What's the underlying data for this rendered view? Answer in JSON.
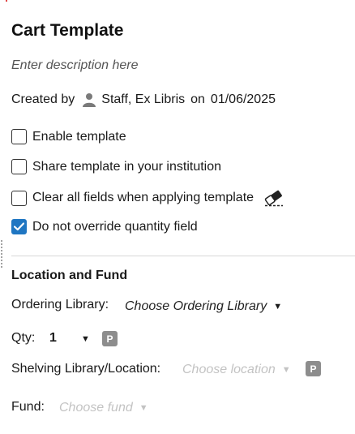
{
  "page": {
    "title": "Cart Template",
    "description_placeholder": "Enter description here",
    "created_by_label": "Created by",
    "created_by_user": "Staff, Ex Libris",
    "on_label": "on",
    "created_date": "01/06/2025"
  },
  "options": [
    {
      "label": "Enable template",
      "checked": false
    },
    {
      "label": "Share template in your institution",
      "checked": false
    },
    {
      "label": "Clear all fields when applying template",
      "checked": false
    },
    {
      "label": "Do not override quantity field",
      "checked": true
    }
  ],
  "location_fund": {
    "section_title": "Location and Fund",
    "ordering_library_label": "Ordering Library:",
    "ordering_library_value": "Choose Ordering Library",
    "qty_label": "Qty:",
    "qty_value": "1",
    "p_badge": "P",
    "shelving_label": "Shelving Library/Location:",
    "shelving_placeholder": "Choose location",
    "fund_label": "Fund:",
    "fund_placeholder": "Choose fund"
  },
  "icons": {
    "person": "person-icon",
    "eraser": "eraser-icon",
    "caret": "caret-down-icon",
    "check": "checkmark-icon"
  },
  "colors": {
    "checked": "#1f76c2",
    "badge": "#8d8d8d",
    "placeholder": "#c3c3c3"
  }
}
